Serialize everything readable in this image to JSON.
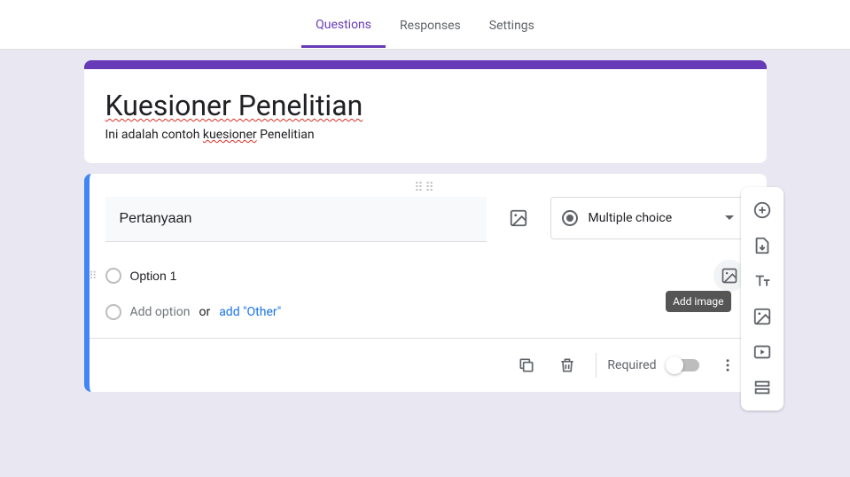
{
  "tabs": {
    "questions": "Questions",
    "responses": "Responses",
    "settings": "Settings"
  },
  "form": {
    "title": "Kuesioner Penelitian",
    "desc_before": "Ini adalah contoh ",
    "desc_sq": "kuesioner",
    "desc_after": " Penelitian"
  },
  "question": {
    "text": "Pertanyaan",
    "type_label": "Multiple choice",
    "option1": "Option 1",
    "add_option": "Add option",
    "or": "or",
    "add_other": "add \"Other\"",
    "required": "Required"
  },
  "tooltip": "Add image"
}
